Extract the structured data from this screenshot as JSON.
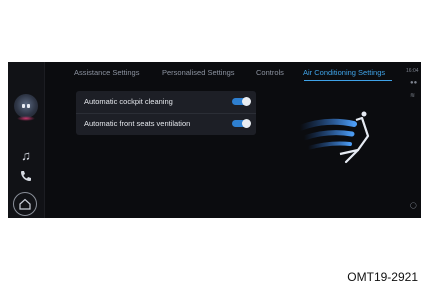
{
  "tabs": [
    {
      "label": "Assistance Settings",
      "active": false
    },
    {
      "label": "Personalised Settings",
      "active": false
    },
    {
      "label": "Controls",
      "active": false
    },
    {
      "label": "Air Conditioning Settings",
      "active": true
    }
  ],
  "settings": [
    {
      "label": "Automatic cockpit cleaning",
      "enabled": true
    },
    {
      "label": "Automatic front seats ventilation",
      "enabled": true
    }
  ],
  "status": {
    "time": "16:04"
  },
  "sidebar_icons": [
    "assistant-avatar-icon",
    "music-note-icon",
    "phone-icon",
    "home-icon"
  ],
  "colors": {
    "accent": "#3fa3e8",
    "toggle_on": "#2e7fd0",
    "background": "#0b0c0f"
  },
  "figure_code": "OMT19-2921"
}
